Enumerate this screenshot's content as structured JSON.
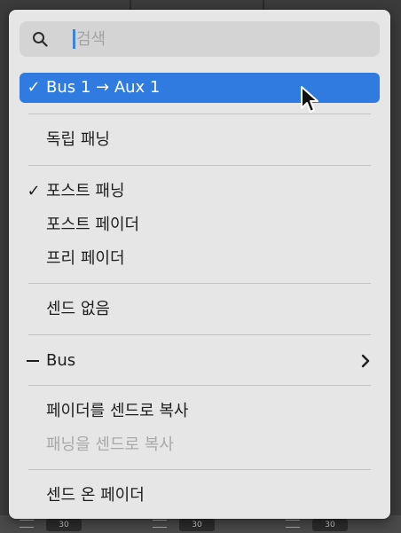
{
  "background": {
    "fader_readouts": [
      "30",
      "30",
      "30"
    ]
  },
  "search": {
    "placeholder": "검색",
    "value": ""
  },
  "menu": {
    "selected": {
      "check": "✓",
      "label": "Bus 1 → Aux 1"
    },
    "independent_pan": {
      "label": "독립 패닝"
    },
    "post_pan": {
      "check": "✓",
      "label": "포스트 패닝"
    },
    "post_fader": {
      "label": "포스트 페이더"
    },
    "pre_fader": {
      "label": "프리 페이더"
    },
    "no_send": {
      "label": "센드 없음"
    },
    "bus": {
      "label": "Bus"
    },
    "copy_fader_to_send": {
      "label": "페이더를 센드로 복사"
    },
    "copy_pan_to_send": {
      "label": "패닝을 센드로 복사"
    },
    "sends_on_fader": {
      "label": "센드 온 페이더"
    }
  },
  "colors": {
    "accent": "#2f7be0",
    "menu_bg": "#e6e6e6",
    "disabled_text": "#a9a9a9"
  }
}
